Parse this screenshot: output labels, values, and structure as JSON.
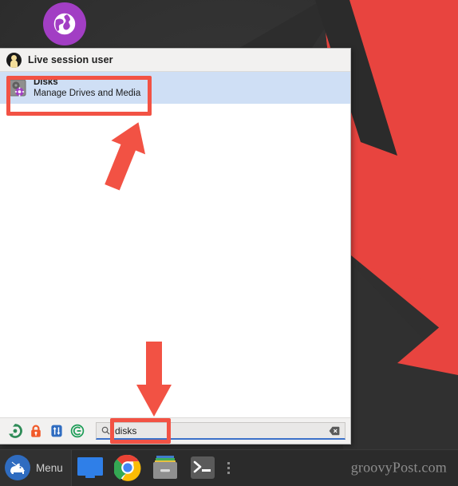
{
  "desktop": {
    "wallpaper_bg": "#323232",
    "wallpaper_accent": "#e8443f",
    "globe_icon_name": "globe-icon",
    "globe_color": "#a23ec4"
  },
  "menu": {
    "header": {
      "user_label": "Live session user",
      "avatar_name": "user-avatar"
    },
    "results": [
      {
        "title": "Disks",
        "subtitle": "Manage Drives and Media",
        "icon": "hard-disk-icon",
        "selected": true
      }
    ],
    "footer": {
      "icons": [
        {
          "name": "software-updates-icon",
          "color": "#2e8b57"
        },
        {
          "name": "lock-screen-icon",
          "color": "#f15a29"
        },
        {
          "name": "switch-user-icon",
          "color": "#2f6cc0"
        },
        {
          "name": "quit-power-icon",
          "color": "#1d9d57"
        }
      ],
      "search": {
        "value": "disks",
        "placeholder": "Search",
        "search_icon": "search-icon",
        "clear_icon": "clear-text-icon",
        "underline_color": "#3c72c9"
      }
    }
  },
  "annotations": {
    "highlight_color": "#f25244",
    "boxes": [
      {
        "name": "highlight-disks-result"
      },
      {
        "name": "highlight-search-field"
      }
    ],
    "arrows": [
      {
        "name": "arrow-pointing-to-disks-result",
        "direction": "up"
      },
      {
        "name": "arrow-pointing-to-search-field",
        "direction": "down"
      }
    ]
  },
  "taskbar": {
    "menu_button_label": "Menu",
    "menu_logo_name": "linux-mint-logo",
    "items": [
      {
        "name": "taskbar-file-manager-icon"
      },
      {
        "name": "taskbar-chrome-icon"
      },
      {
        "name": "taskbar-archive-manager-icon"
      },
      {
        "name": "taskbar-terminal-icon"
      }
    ],
    "overflow_name": "taskbar-overflow-dots",
    "watermark": "groovyPost.com"
  }
}
